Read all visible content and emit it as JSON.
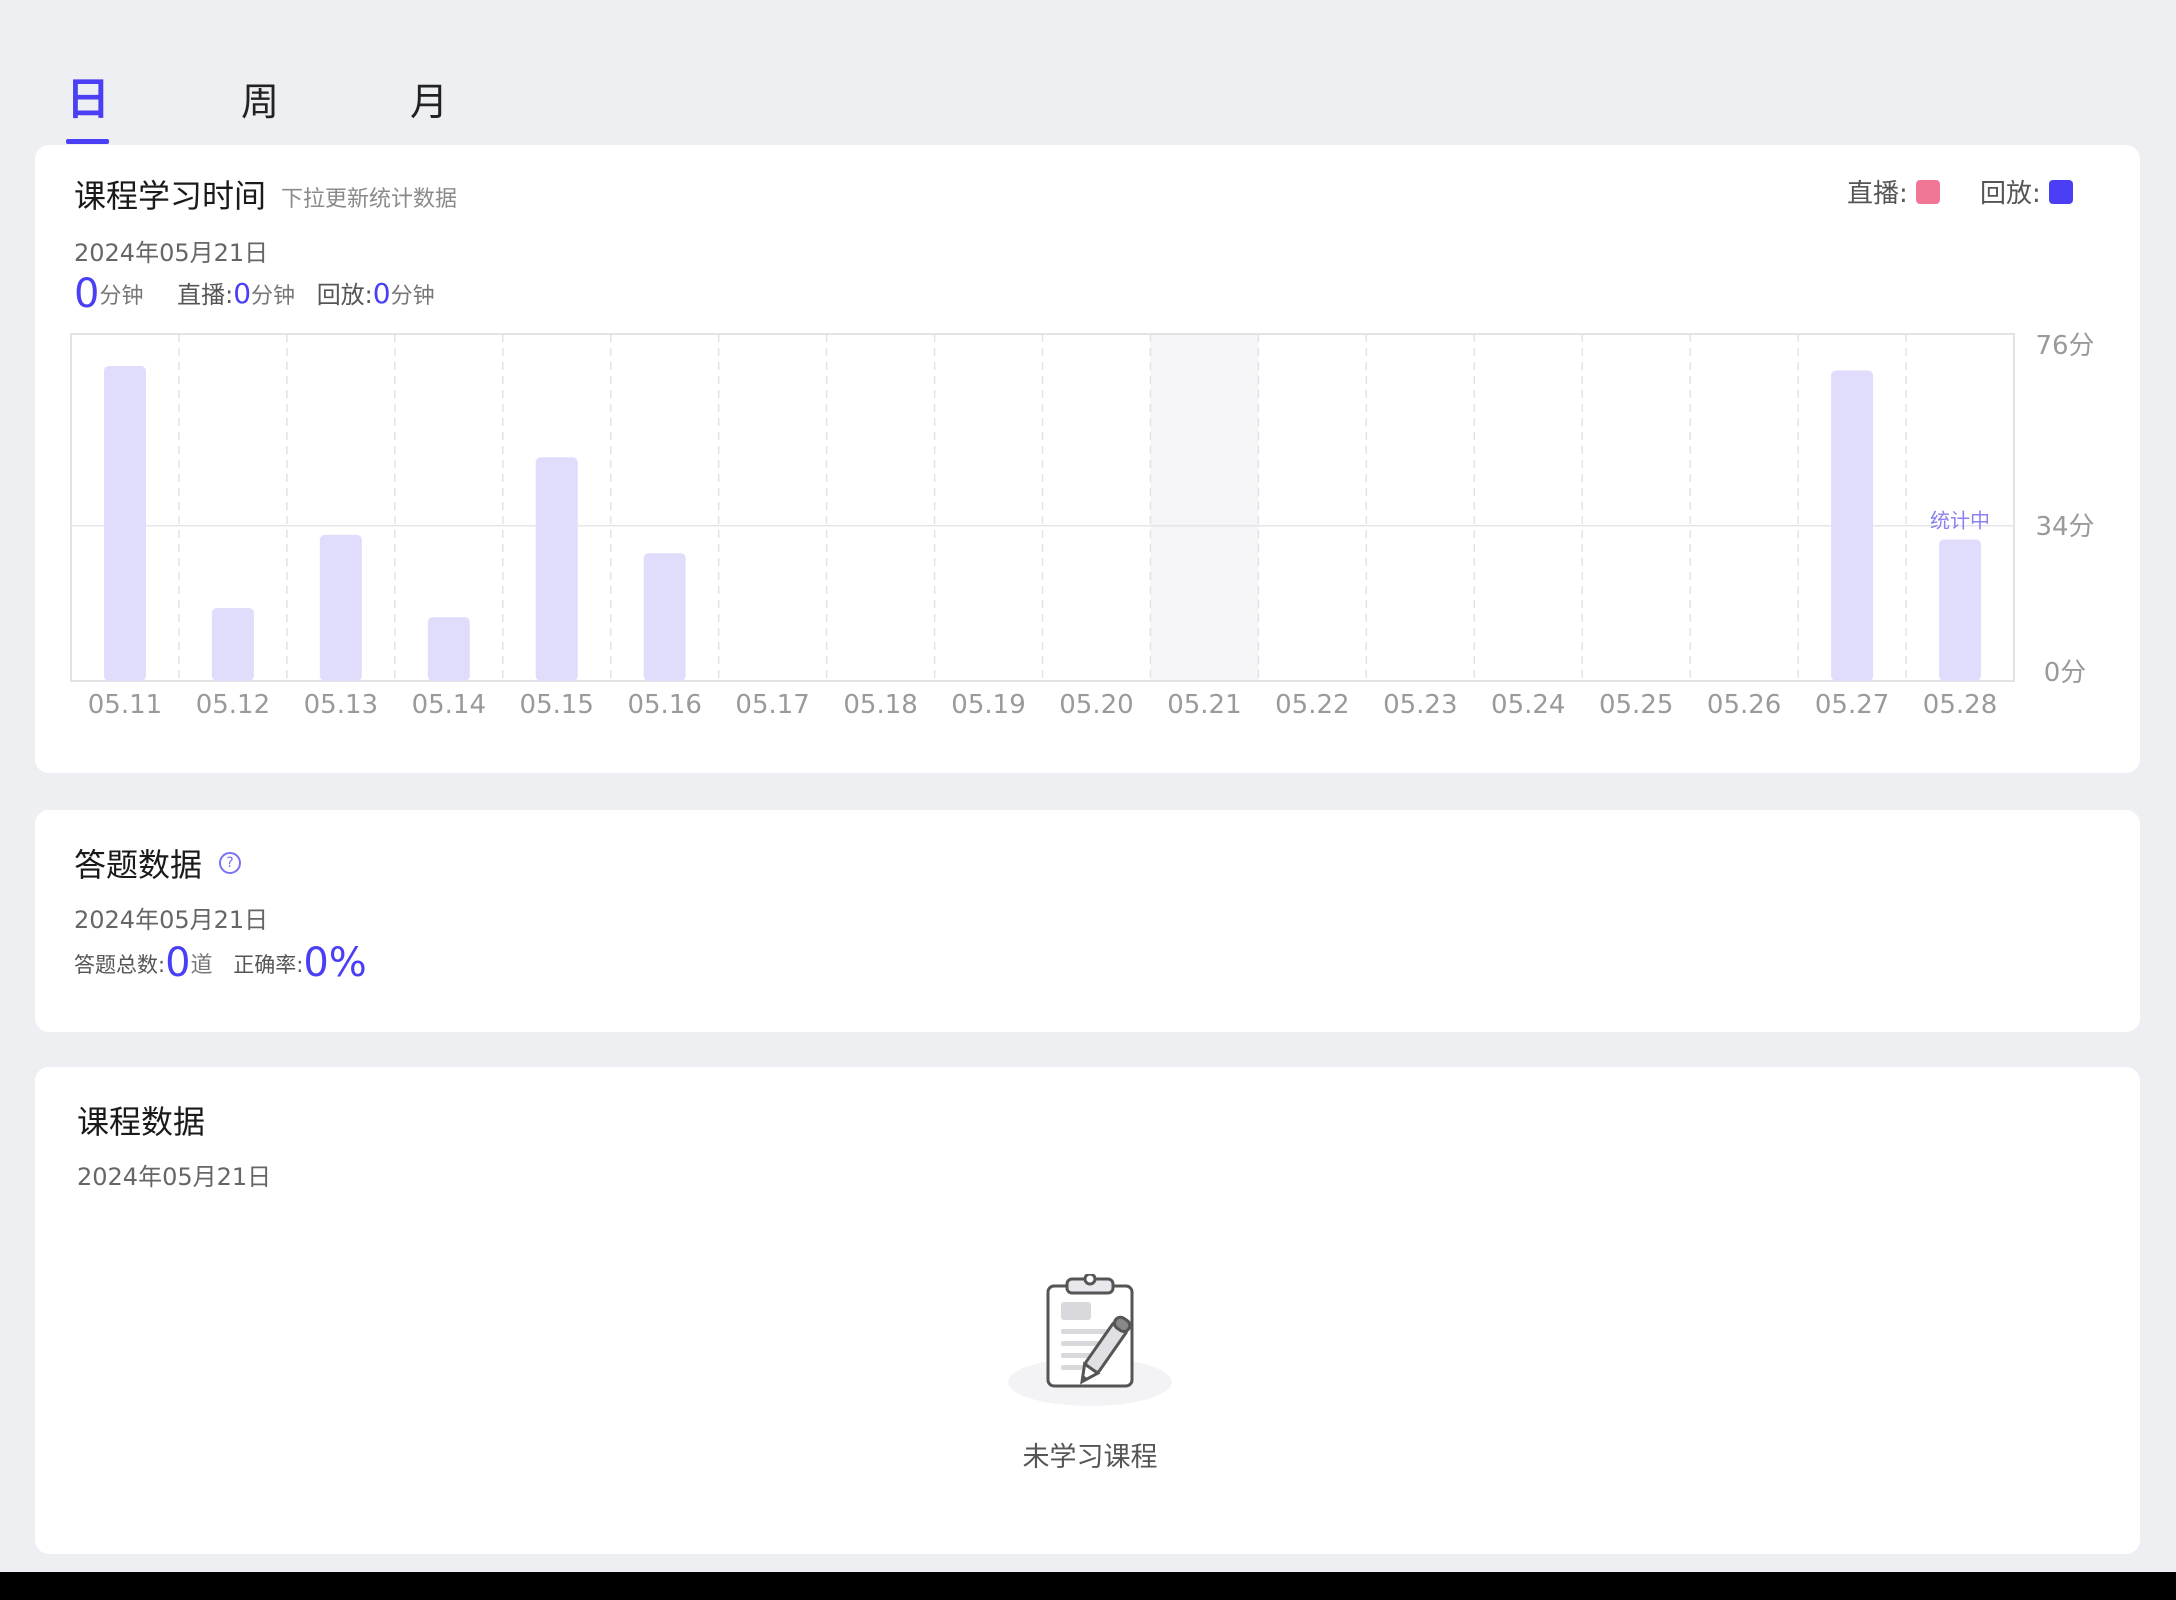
{
  "tabs": [
    {
      "label": "日",
      "active": true
    },
    {
      "label": "周",
      "active": false
    },
    {
      "label": "月",
      "active": false
    }
  ],
  "study_time": {
    "title": "课程学习时间",
    "subtitle": "下拉更新统计数据",
    "date": "2024年05月21日",
    "total_value": "0",
    "total_unit": "分钟",
    "live_label": "直播:",
    "live_value": "0",
    "live_unit": "分钟",
    "replay_label": "回放:",
    "replay_value": "0",
    "replay_unit": "分钟",
    "legend": {
      "live_label": "直播:",
      "live_color": "#f07896",
      "replay_label": "回放:",
      "replay_color": "#4a3ff5"
    }
  },
  "chart_data": {
    "type": "bar",
    "categories": [
      "05.11",
      "05.12",
      "05.13",
      "05.14",
      "05.15",
      "05.16",
      "05.17",
      "05.18",
      "05.19",
      "05.20",
      "05.21",
      "05.22",
      "05.23",
      "05.24",
      "05.25",
      "05.26",
      "05.27",
      "05.28"
    ],
    "values": [
      69,
      16,
      32,
      14,
      49,
      28,
      0,
      0,
      0,
      0,
      0,
      0,
      0,
      0,
      0,
      0,
      68,
      31
    ],
    "ylim": [
      0,
      76
    ],
    "ytick_labels": [
      "76分",
      "34分",
      "0分"
    ],
    "ytick_values": [
      76,
      34,
      0
    ],
    "highlight_category": "05.21",
    "annotation": {
      "category": "05.28",
      "text": "统计中"
    },
    "bar_color": "#e0ddfc",
    "grid": true
  },
  "answers": {
    "title": "答题数据",
    "help_icon": "question-circle-icon",
    "date": "2024年05月21日",
    "total_label": "答题总数:",
    "total_value": "0",
    "total_unit": "道",
    "accuracy_label": "正确率:",
    "accuracy_value": "0%"
  },
  "courses": {
    "title": "课程数据",
    "date": "2024年05月21日",
    "empty_icon": "clipboard-pencil-icon",
    "empty_text": "未学习课程"
  }
}
